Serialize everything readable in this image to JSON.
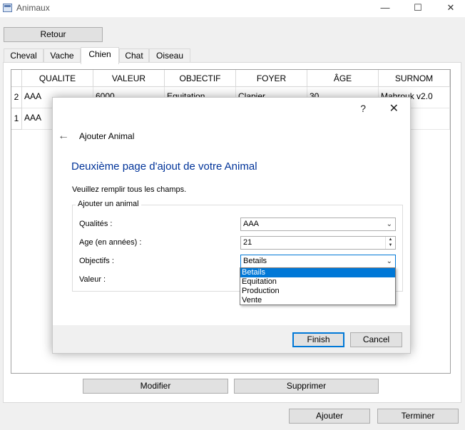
{
  "window": {
    "title": "Animaux",
    "controls": {
      "minimize": "—",
      "maximize": "☐",
      "close": "✕"
    }
  },
  "toolbar": {
    "back_label": "Retour"
  },
  "tabs": [
    "Cheval",
    "Vache",
    "Chien",
    "Chat",
    "Oiseau"
  ],
  "active_tab": "Chien",
  "table": {
    "columns": [
      "QUALITE",
      "VALEUR",
      "OBJECTIF",
      "FOYER",
      "ÂGE",
      "SURNOM"
    ],
    "rows": [
      {
        "index": "2",
        "cells": [
          "AAA",
          "6000",
          "Equitation",
          "Clapier",
          "30",
          "Mabrouk v2.0"
        ]
      },
      {
        "index": "1",
        "cells": [
          "AAA",
          "",
          "",
          "",
          "",
          ""
        ]
      }
    ]
  },
  "actions": {
    "modify": "Modifier",
    "delete": "Supprimer",
    "add": "Ajouter",
    "finish": "Terminer"
  },
  "dialog": {
    "help": "?",
    "close": "✕",
    "back": "←",
    "wizard_title": "Ajouter Animal",
    "page_heading": "Deuxième page d'ajout de votre Animal",
    "subtitle": "Veuillez remplir tous les champs.",
    "group_title": "Ajouter un animal",
    "fields": {
      "qualites": {
        "label": "Qualités :",
        "value": "AAA"
      },
      "age": {
        "label": "Age (en années) :",
        "value": "21"
      },
      "objectifs": {
        "label": "Objectifs :",
        "value": "Betails"
      },
      "valeur": {
        "label": "Valeur :"
      }
    },
    "dropdown_options": [
      "Betails",
      "Equitation",
      "Production",
      "Vente"
    ],
    "finish_label": "Finish",
    "cancel_label": "Cancel"
  }
}
